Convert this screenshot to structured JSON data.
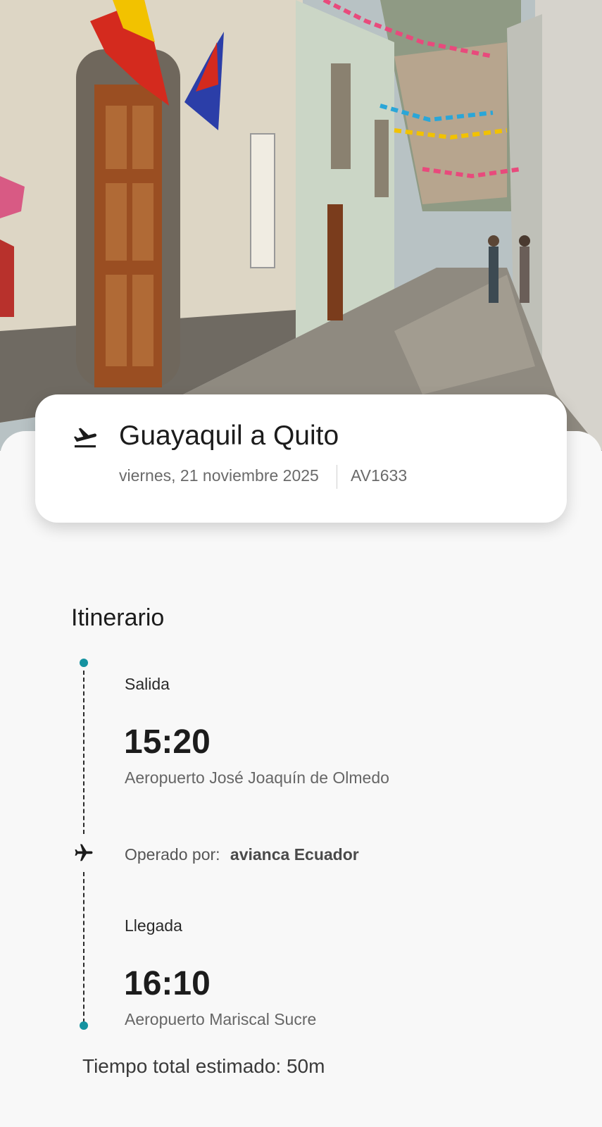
{
  "hero": {
    "image": "street-photo",
    "colors": {
      "sky": "#9fb6c9",
      "wall_left": "#d8d2c2",
      "wall_right": "#cdd5c8",
      "door": "#9a4e22",
      "cobblestone": "#8f8a80"
    }
  },
  "flight": {
    "icon": "flight-takeoff-icon",
    "route": "Guayaquil a Quito",
    "date": "viernes, 21 noviembre 2025",
    "number": "AV1633"
  },
  "itinerary": {
    "title": "Itinerario",
    "accent_color": "#1592a0",
    "departure": {
      "label": "Salida",
      "time": "15:20",
      "airport": "Aeropuerto José Joaquín de Olmedo"
    },
    "operated_by": {
      "icon": "airplane-icon",
      "label": "Operado por:",
      "carrier": "avianca Ecuador"
    },
    "arrival": {
      "label": "Llegada",
      "time": "16:10",
      "airport": "Aeropuerto Mariscal Sucre"
    },
    "total_time": "Tiempo total estimado: 50m"
  }
}
